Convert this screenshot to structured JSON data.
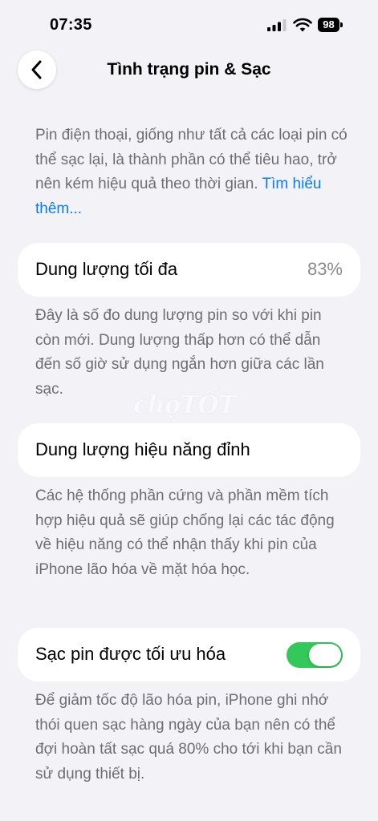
{
  "status_bar": {
    "time": "07:35",
    "battery_level": "98",
    "icons": [
      "signal-icon",
      "wifi-icon",
      "battery-icon"
    ]
  },
  "header": {
    "title": "Tình trạng pin & Sạc",
    "back_icon": "chevron-left-icon"
  },
  "intro": {
    "text": "Pin điện thoại, giống như tất cả các loại pin có thể sạc lại, là thành phần có thể tiêu hao, trở nên kém hiệu quả theo thời gian.",
    "link_text": "Tìm hiểu thêm..."
  },
  "max_capacity": {
    "label": "Dung lượng tối đa",
    "value": "83%",
    "description": "Đây là số đo dung lượng pin so với khi pin còn mới. Dung lượng thấp hơn có thể dẫn đến số giờ sử dụng ngắn hơn giữa các lần sạc."
  },
  "peak_performance": {
    "label": "Dung lượng hiệu năng đỉnh",
    "description": "Các hệ thống phần cứng và phần mềm tích hợp hiệu quả sẽ giúp chống lại các tác động về hiệu năng có thể nhận thấy khi pin của iPhone lão hóa về mặt hóa học."
  },
  "optimized_charging": {
    "label": "Sạc pin được tối ưu hóa",
    "enabled": true,
    "description": "Để giảm tốc độ lão hóa pin, iPhone ghi nhớ thói quen sạc hàng ngày của bạn nên có thể đợi hoàn tất sạc quá 80% cho tới khi bạn cần sử dụng thiết bị."
  },
  "watermark": {
    "text": "chợTỐT"
  },
  "colors": {
    "background": "#f2f2f7",
    "card": "#ffffff",
    "link": "#0a7aff",
    "toggle_on": "#34c759",
    "secondary_text": "#6d6d72"
  }
}
